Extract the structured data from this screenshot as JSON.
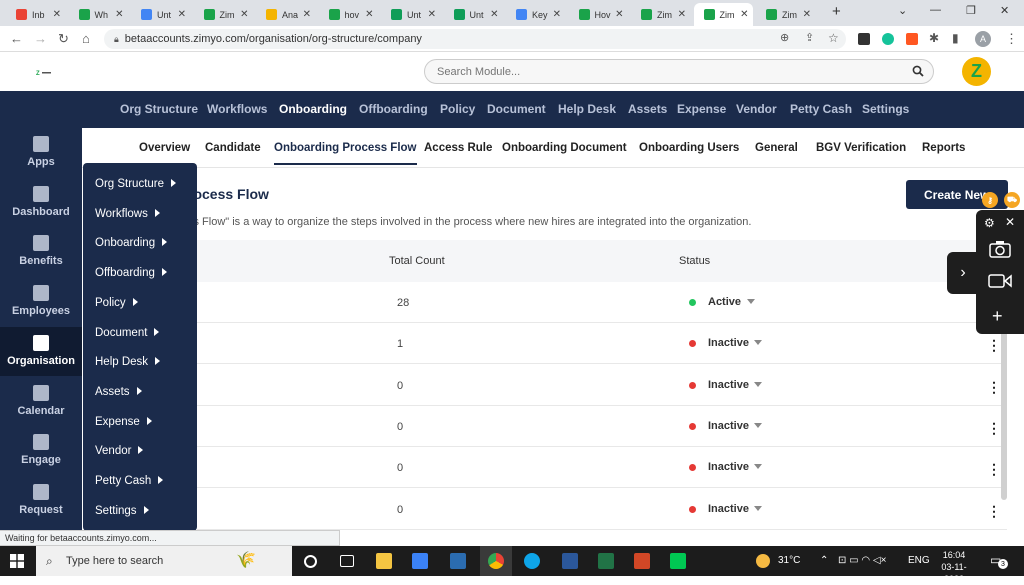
{
  "browser": {
    "tabs": [
      {
        "label": "Inb",
        "icon": "gmail-icon",
        "color": "#ea4335"
      },
      {
        "label": "Wh",
        "icon": "zimyo-icon",
        "color": "#1aa34a"
      },
      {
        "label": "Unt",
        "icon": "docs-icon",
        "color": "#4285f4"
      },
      {
        "label": "Zim",
        "icon": "zimyo-icon",
        "color": "#1aa34a"
      },
      {
        "label": "Ana",
        "icon": "analytics-icon",
        "color": "#f4b400"
      },
      {
        "label": "hov",
        "icon": "zimyo-icon",
        "color": "#1aa34a"
      },
      {
        "label": "Unt",
        "icon": "sheets-icon",
        "color": "#0f9d58"
      },
      {
        "label": "Unt",
        "icon": "sheets-icon",
        "color": "#0f9d58"
      },
      {
        "label": "Key",
        "icon": "ads-icon",
        "color": "#4285f4"
      },
      {
        "label": "Hov",
        "icon": "zimyo-icon",
        "color": "#1aa34a"
      },
      {
        "label": "Zim",
        "icon": "zimyo-icon",
        "color": "#1aa34a"
      },
      {
        "label": "Zim",
        "icon": "zimyo-icon",
        "color": "#1aa34a",
        "active": true
      },
      {
        "label": "Zim",
        "icon": "zimyo-icon",
        "color": "#1aa34a"
      }
    ],
    "url": "betaaccounts.zimyo.com/organisation/org-structure/company",
    "status_text": "Waiting for betaaccounts.zimyo.com...",
    "profile_letter": "A"
  },
  "header": {
    "search_placeholder": "Search Module...",
    "avatar_letter": "Z"
  },
  "topnav": [
    "Org Structure",
    "Workflows",
    "Onboarding",
    "Offboarding",
    "Policy",
    "Document",
    "Help Desk",
    "Assets",
    "Expense",
    "Vendor",
    "Petty Cash",
    "Settings"
  ],
  "topnav_active": "Onboarding",
  "sidebar": [
    {
      "label": "Apps",
      "icon": "apps-icon"
    },
    {
      "label": "Dashboard",
      "icon": "dashboard-icon"
    },
    {
      "label": "Benefits",
      "icon": "benefits-icon"
    },
    {
      "label": "Employees",
      "icon": "employees-icon"
    },
    {
      "label": "Organisation",
      "icon": "organisation-icon",
      "active": true
    },
    {
      "label": "Calendar",
      "icon": "calendar-icon"
    },
    {
      "label": "Engage",
      "icon": "engage-icon"
    },
    {
      "label": "Request",
      "icon": "request-icon"
    }
  ],
  "subtabs": [
    "Overview",
    "Candidate",
    "Onboarding Process Flow",
    "Access Rule",
    "Onboarding Document",
    "Onboarding Users",
    "General",
    "BGV Verification",
    "Reports"
  ],
  "subtab_active": "Onboarding Process Flow",
  "page": {
    "title": "rocess Flow",
    "description": "ss Flow\" is a way to organize the steps involved in the process where new hires are integrated into the organization.",
    "create_button": "Create New"
  },
  "table": {
    "headers": {
      "count": "Total Count",
      "status": "Status"
    },
    "rows": [
      {
        "count": "28",
        "status": "Active"
      },
      {
        "count": "1",
        "status": "Inactive"
      },
      {
        "count": "0",
        "status": "Inactive"
      },
      {
        "count": "0",
        "status": "Inactive"
      },
      {
        "count": "0",
        "status": "Inactive"
      },
      {
        "count": "0",
        "status": "Inactive"
      }
    ]
  },
  "colors": {
    "nav": "#1b2b4b",
    "active_dot": "#22c55e",
    "inactive_dot": "#e53935",
    "brand": "#1aa34a"
  },
  "flyout": [
    "Org Structure",
    "Workflows",
    "Onboarding",
    "Offboarding",
    "Policy",
    "Document",
    "Help Desk",
    "Assets",
    "Expense",
    "Vendor",
    "Petty Cash",
    "Settings"
  ],
  "taskbar": {
    "search_placeholder": "Type here to search",
    "temperature": "31°C",
    "language": "ENG",
    "time": "16:04",
    "date": "03-11-2022",
    "notification_count": "3"
  }
}
